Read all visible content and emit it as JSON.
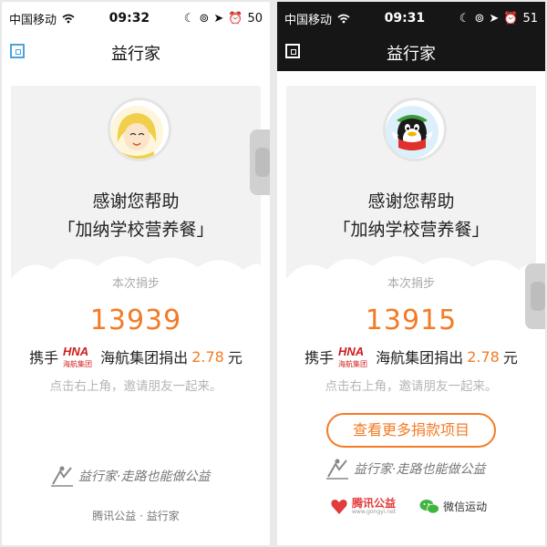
{
  "colors": {
    "accent": "#f37b25",
    "link_blue": "#4aa3e0"
  },
  "left": {
    "status": {
      "carrier": "中国移动",
      "time": "09:32",
      "battery": "50"
    },
    "title": "益行家",
    "avatar_icon": "girl-avatar-icon",
    "thanks_line1": "感谢您帮助",
    "thanks_line2": "「加纳学校营养餐」",
    "step_label": "本次捐步",
    "steps": "13939",
    "donor": {
      "prefix": "携手",
      "logo_text": "HNA",
      "logo_sub": "海航集团",
      "company": "海航集团捐出",
      "amount": "2.78",
      "unit": "元"
    },
    "invite": "点击右上角，邀请朋友一起来。",
    "brand_text": "益行家·走路也能做公益",
    "footer": "腾讯公益 · 益行家"
  },
  "right": {
    "status": {
      "carrier": "中国移动",
      "time": "09:31",
      "battery": "51"
    },
    "title": "益行家",
    "avatar_icon": "qq-penguin-avatar-icon",
    "thanks_line1": "感谢您帮助",
    "thanks_line2": "「加纳学校营养餐」",
    "step_label": "本次捐步",
    "steps": "13915",
    "donor": {
      "prefix": "携手",
      "logo_text": "HNA",
      "logo_sub": "海航集团",
      "company": "海航集团捐出",
      "amount": "2.78",
      "unit": "元"
    },
    "invite": "点击右上角，邀请朋友一起来。",
    "more_button": "查看更多捐款项目",
    "brand_text": "益行家·走路也能做公益",
    "partner1": "腾讯公益",
    "partner1_sub": "www.gongyi.net",
    "partner2": "微信运动"
  }
}
